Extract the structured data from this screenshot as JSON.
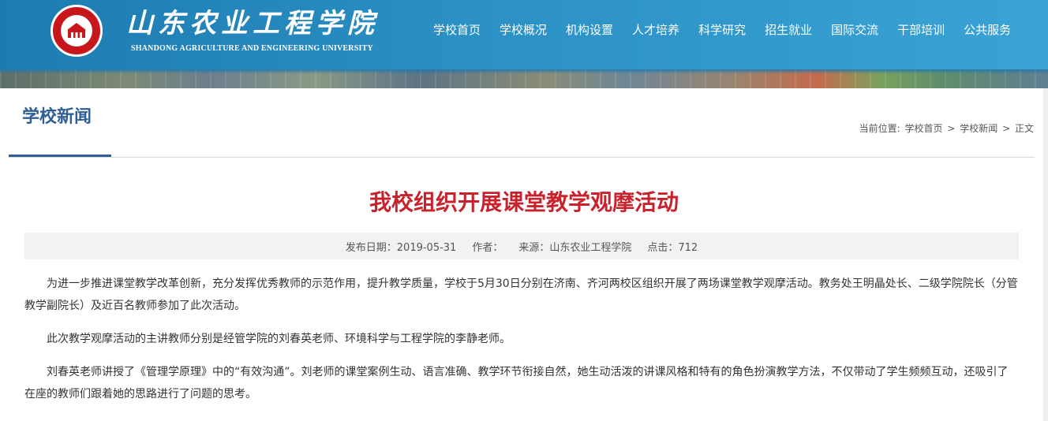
{
  "header": {
    "logo_name_cn": "山东农业工程学院",
    "logo_name_en": "SHANDONG AGRICULTURE AND ENGINEERING UNIVERSITY",
    "seal_text": "山东农业工程学院",
    "nav": [
      "学校首页",
      "学校概况",
      "机构设置",
      "人才培养",
      "科学研究",
      "招生就业",
      "国际交流",
      "干部培训",
      "公共服务"
    ]
  },
  "section": {
    "title": "学校新闻",
    "breadcrumb": {
      "prefix": "当前位置:",
      "items": [
        "学校首页",
        "学校新闻",
        "正文"
      ],
      "separator": ">"
    }
  },
  "article": {
    "title": "我校组织开展课堂教学观摩活动",
    "meta": {
      "date": "发布日期：2019-05-31",
      "author": "作者：",
      "source": "来源：山东农业工程学院",
      "views": "点击：712"
    },
    "paragraphs": [
      "为进一步推进课堂教学改革创新，充分发挥优秀教师的示范作用，提升教学质量，学校于5月30日分别在济南、齐河两校区组织开展了两场课堂教学观摩活动。教务处王明晶处长、二级学院院长（分管教学副院长）及近百名教师参加了此次活动。",
      "此次教学观摩活动的主讲教师分别是经管学院的刘春英老师、环境科学与工程学院的李静老师。",
      "刘春英老师讲授了《管理学原理》中的“有效沟通”。刘老师的课堂案例生动、语言准确、教学环节衔接自然，她生动活泼的讲课风格和特有的角色扮演教学方法，不仅带动了学生频频互动，还吸引了在座的教师们跟着她的思路进行了问题的思考。"
    ]
  },
  "colors": {
    "header_blue": "#2b90c4",
    "section_title": "#2f5f94",
    "article_title": "#c8232c",
    "seal_red": "#c8161d"
  }
}
